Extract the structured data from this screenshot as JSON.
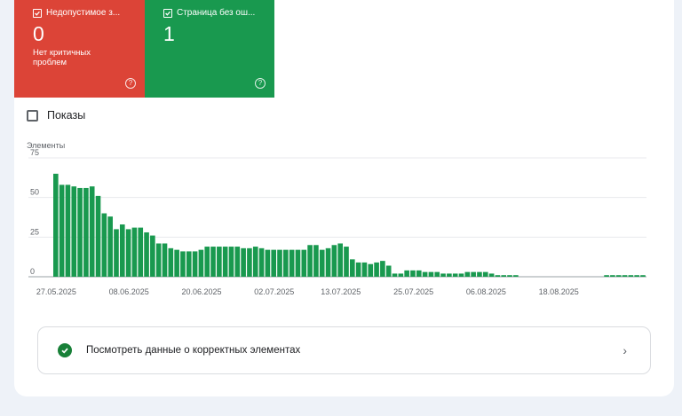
{
  "tiles": [
    {
      "label": "Недопустимое з...",
      "count": "0",
      "description": "Нет критичных проблем",
      "color": "#dc4437",
      "checked": true,
      "help_icon": "help-circle-icon"
    },
    {
      "label": "Страница без ош...",
      "count": "1",
      "description": "",
      "color": "#19994f",
      "checked": true,
      "help_icon": "help-circle-icon"
    }
  ],
  "impressions_toggle": {
    "label": "Показы",
    "checked": false
  },
  "details_link": {
    "label": "Посмотреть данные о корректных элементах",
    "icon": "check-circle-icon",
    "chevron": "chevron-right-icon"
  },
  "chart_data": {
    "type": "bar",
    "ylabel": "Элементы",
    "ylim": [
      0,
      75
    ],
    "yticks": [
      0,
      25,
      50,
      75
    ],
    "grid": true,
    "bar_color": "#19994f",
    "x_tick_labels": [
      "27.05.2025",
      "08.06.2025",
      "20.06.2025",
      "02.07.2025",
      "13.07.2025",
      "25.07.2025",
      "06.08.2025",
      "18.08.2025"
    ],
    "values": [
      65,
      58,
      58,
      57,
      56,
      56,
      57,
      51,
      40,
      38,
      30,
      33,
      30,
      31,
      31,
      28,
      26,
      21,
      21,
      18,
      17,
      16,
      16,
      16,
      17,
      19,
      19,
      19,
      19,
      19,
      19,
      18,
      18,
      19,
      18,
      17,
      17,
      17,
      17,
      17,
      17,
      17,
      20,
      20,
      17,
      18,
      20,
      21,
      19,
      11,
      9,
      9,
      8,
      9,
      10,
      7,
      2,
      2,
      4,
      4,
      4,
      3,
      3,
      3,
      2,
      2,
      2,
      2,
      3,
      3,
      3,
      3,
      2,
      1,
      1,
      1,
      1,
      0,
      0,
      0,
      0,
      0,
      0,
      0,
      0,
      0,
      0,
      0,
      0,
      0,
      0,
      1,
      1,
      1,
      1,
      1,
      1,
      1
    ]
  }
}
